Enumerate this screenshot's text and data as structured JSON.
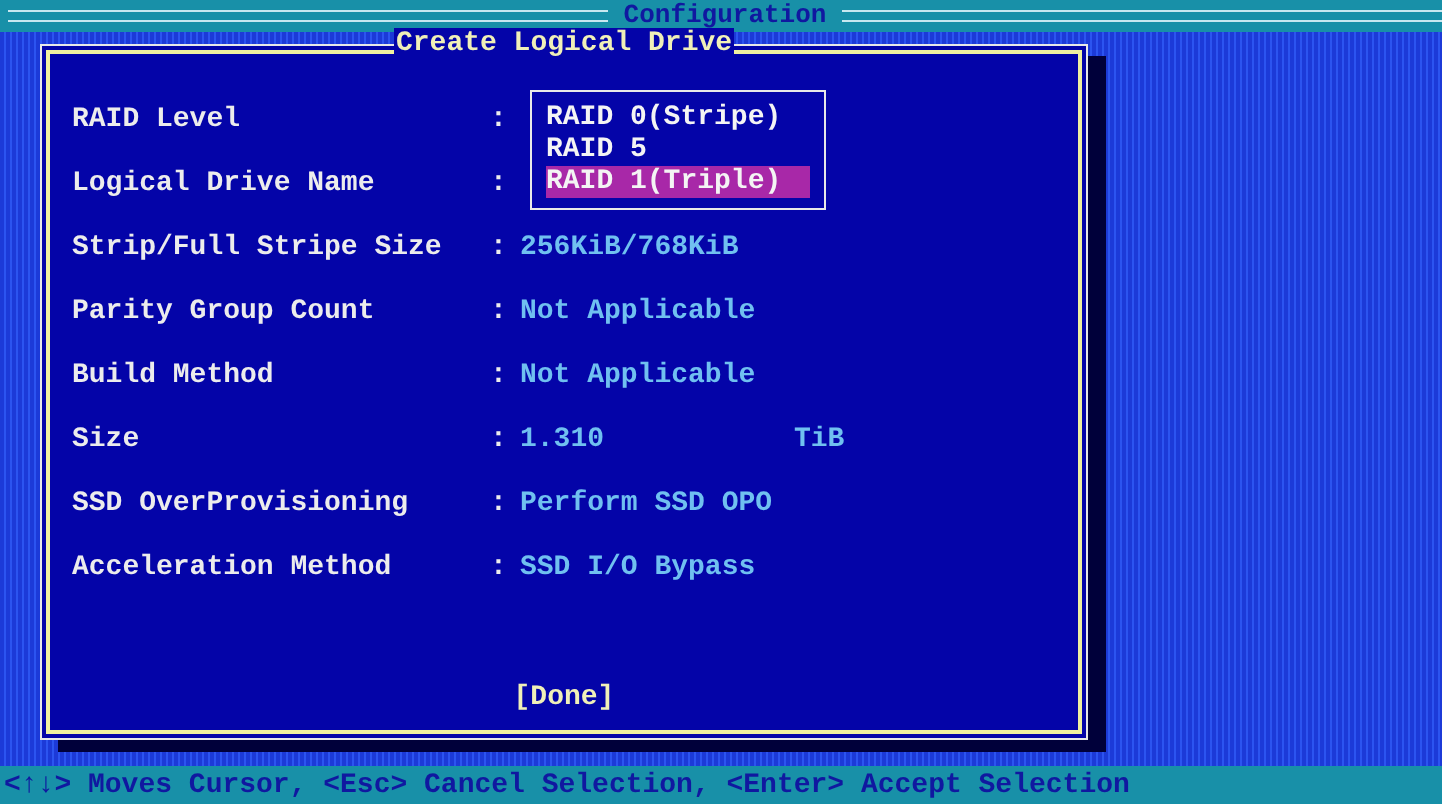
{
  "header": {
    "title": "Configuration"
  },
  "dialog": {
    "title": "Create Logical Drive",
    "rows": [
      {
        "label": "RAID Level"
      },
      {
        "label": "Logical Drive Name"
      },
      {
        "label": "Strip/Full Stripe Size",
        "value": "256KiB/768KiB"
      },
      {
        "label": "Parity Group Count",
        "value": "Not Applicable"
      },
      {
        "label": "Build Method",
        "value": "Not Applicable"
      },
      {
        "label": "Size",
        "value": "1.310",
        "unit": "TiB"
      },
      {
        "label": "SSD OverProvisioning",
        "value": "Perform SSD OPO"
      },
      {
        "label": "Acceleration Method",
        "value": "SSD I/O Bypass"
      }
    ],
    "separator": ":",
    "dropdown": {
      "options": [
        {
          "text": "RAID 0(Stripe)",
          "selected": false
        },
        {
          "text": "RAID 5",
          "selected": false
        },
        {
          "text": "RAID 1(Triple)",
          "selected": true
        }
      ]
    },
    "done_button": "[Done]"
  },
  "status_bar": "<↑↓> Moves Cursor, <Esc> Cancel Selection, <Enter> Accept Selection"
}
